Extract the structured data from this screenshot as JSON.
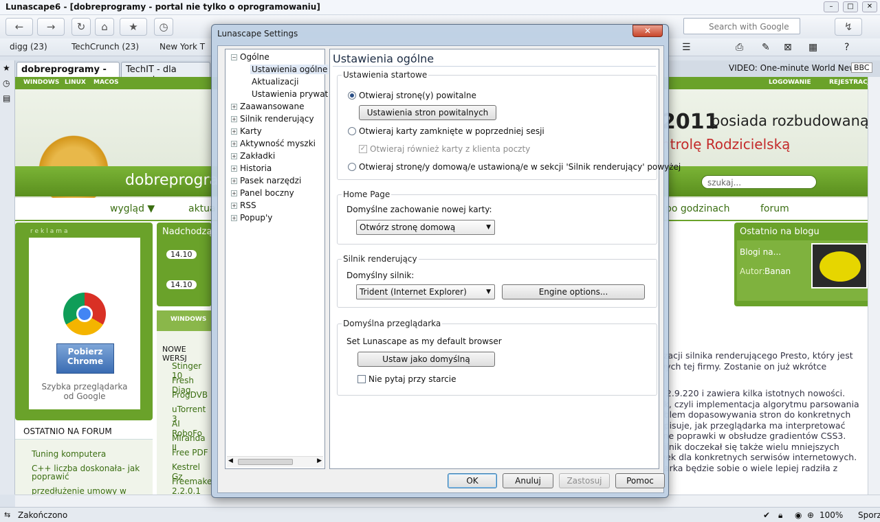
{
  "window": {
    "title": "Lunascape6 - [dobreprogramy - portal nie tylko o oprogramowaniu]"
  },
  "toolbar": {
    "search_placeholder": "Search with Google"
  },
  "bookmarks": [
    "digg (23)",
    "TechCrunch (23)",
    "New York T"
  ],
  "tabs": [
    "dobreprogramy - ...",
    "TechIT - dla wszyst"
  ],
  "news_ticker": "VIDEO: One-minute World News",
  "news_source": "BBC",
  "site": {
    "nav_top": [
      "WINDOWS",
      "LINUX",
      "MACOS"
    ],
    "login": "LOGOWANIE",
    "register": "REJESTRACJA",
    "headline_1": "2011",
    "headline_2": "posiada rozbudowaną",
    "headline_3": "ntrolę Rodzicielską",
    "logo_text": "dobreprogra",
    "search_placeholder": "szukaj...",
    "menu": [
      "wygląd ▼",
      "aktua",
      "po godzinach",
      "forum"
    ],
    "ad_label": "reklama",
    "ad_button": "Pobierz Chrome",
    "ad_tagline": "Szybka przeglądarka od Google",
    "upcoming": "Nadchodzą",
    "dates": [
      "14.10",
      "14.10"
    ],
    "blog_title": "Ostatnio na blogu",
    "blog_item": "Blogi na...",
    "blog_author_label": "Autor:",
    "blog_author": "Banan",
    "forum_title": "OSTATNIO NA FORUM",
    "forum_items": [
      "Tuning komputera",
      "C++ liczba doskonała- jak poprawić",
      "przedłużenie umowy w"
    ],
    "win_tab": "WINDOWS",
    "new_versions": "NOWE WERSJ",
    "versions": [
      "Stinger 10",
      "Fresh Diag",
      "ProgDVB",
      "uTorrent 3",
      "AI RoboFo",
      "Miranda II",
      "Free PDF",
      "Kestrel Gz",
      "Freemake 2.2.0.1"
    ],
    "article": [
      "lizacji silnika renderującego Presto, który jest",
      "wych tej firmy. Zostanie on już wkrótce",
      "ji 2.9.220 i zawiera kilka istotnych nowości.",
      "ok, czyli implementacja algorytmu parsowania",
      "oblem dopasowywania stron do konkretnych",
      "opisuje, jak przeglądarka ma interpretować",
      "zne poprawki w obsłudze gradientów CSS3.",
      "Silnik doczekał się także wielu mniejszych",
      "wek dla konkretnych serwisów internetowych.",
      "darka będzie sobie o wiele lepiej radziła z"
    ]
  },
  "status": {
    "text": "Zakończono",
    "zoom": "100%",
    "sporz": "Sporz"
  },
  "dialog": {
    "title": "Lunascape Settings",
    "close": "✕",
    "tree": {
      "general": "Ogólne",
      "general_children": [
        "Ustawienia ogólne",
        "Aktualizacji",
        "Ustawienia prywat"
      ],
      "others": [
        "Zaawansowane",
        "Silnik renderujący",
        "Karty",
        "Aktywność myszki",
        "Zakładki",
        "Historia",
        "Pasek narzędzi",
        "Panel boczny",
        "RSS",
        "Popup'y"
      ]
    },
    "page_title": "Ustawienia ogólne",
    "startup": {
      "legend": "Ustawienia startowe",
      "opt1": "Otwieraj stronę(y) powitalne",
      "btn1": "Ustawienia stron powitalnych",
      "opt2": "Otwieraj karty zamknięte w poprzedniej sesji",
      "opt2_sub": "Otwieraj również karty z klienta poczty",
      "opt3": "Otwieraj stronę/y domową/e ustawioną/e w sekcji 'Silnik renderujący' powyżej"
    },
    "home": {
      "legend": "Home Page",
      "label": "Domyślne zachowanie nowej karty:",
      "value": "Otwórz stronę domową"
    },
    "engine": {
      "legend": "Silnik renderujący",
      "label": "Domyślny silnik:",
      "value": "Trident (Internet Explorer)",
      "options_btn": "Engine options..."
    },
    "default_browser": {
      "legend": "Domyślna przeglądarka",
      "label": "Set Lunascape as my default browser",
      "btn": "Ustaw jako domyślną",
      "check": "Nie pytaj przy starcie"
    },
    "buttons": {
      "ok": "OK",
      "cancel": "Anuluj",
      "apply": "Zastosuj",
      "help": "Pomoc"
    }
  }
}
